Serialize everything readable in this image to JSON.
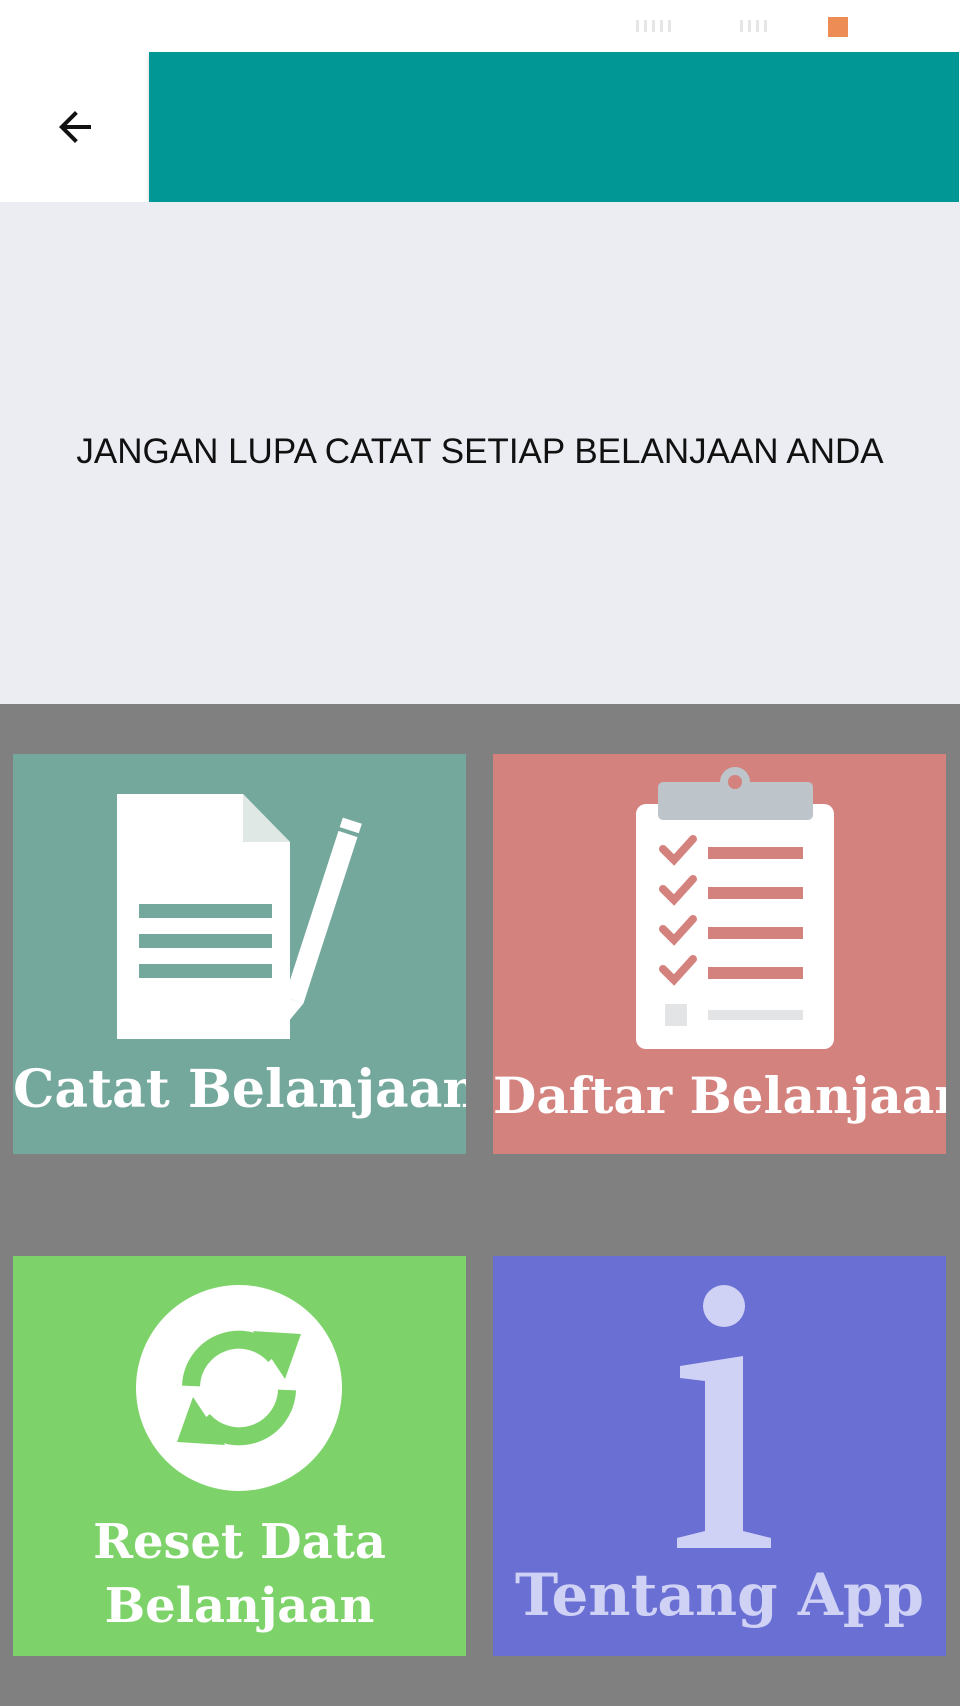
{
  "app_bar": {
    "back_icon": "arrow-back-icon",
    "color": "#009794"
  },
  "banner": {
    "text": "JANGAN LUPA CATAT SETIAP BELANJAAN ANDA",
    "background": "#ecedf2"
  },
  "menu": {
    "tiles": [
      {
        "label": "Catat Belanjaan",
        "icon": "document-pen-icon",
        "color": "#74a89c"
      },
      {
        "label": "Daftar Belanjaan",
        "icon": "clipboard-checklist-icon",
        "color": "#d3827e"
      },
      {
        "label_line1": "Reset Data",
        "label_line2": "Belanjaan",
        "icon": "refresh-icon",
        "color": "#7dd36a"
      },
      {
        "label": "Tentang App",
        "icon": "info-icon",
        "color": "#6a6fd3"
      }
    ]
  },
  "status_bar": {
    "indicator_color": "#ee8c55"
  }
}
